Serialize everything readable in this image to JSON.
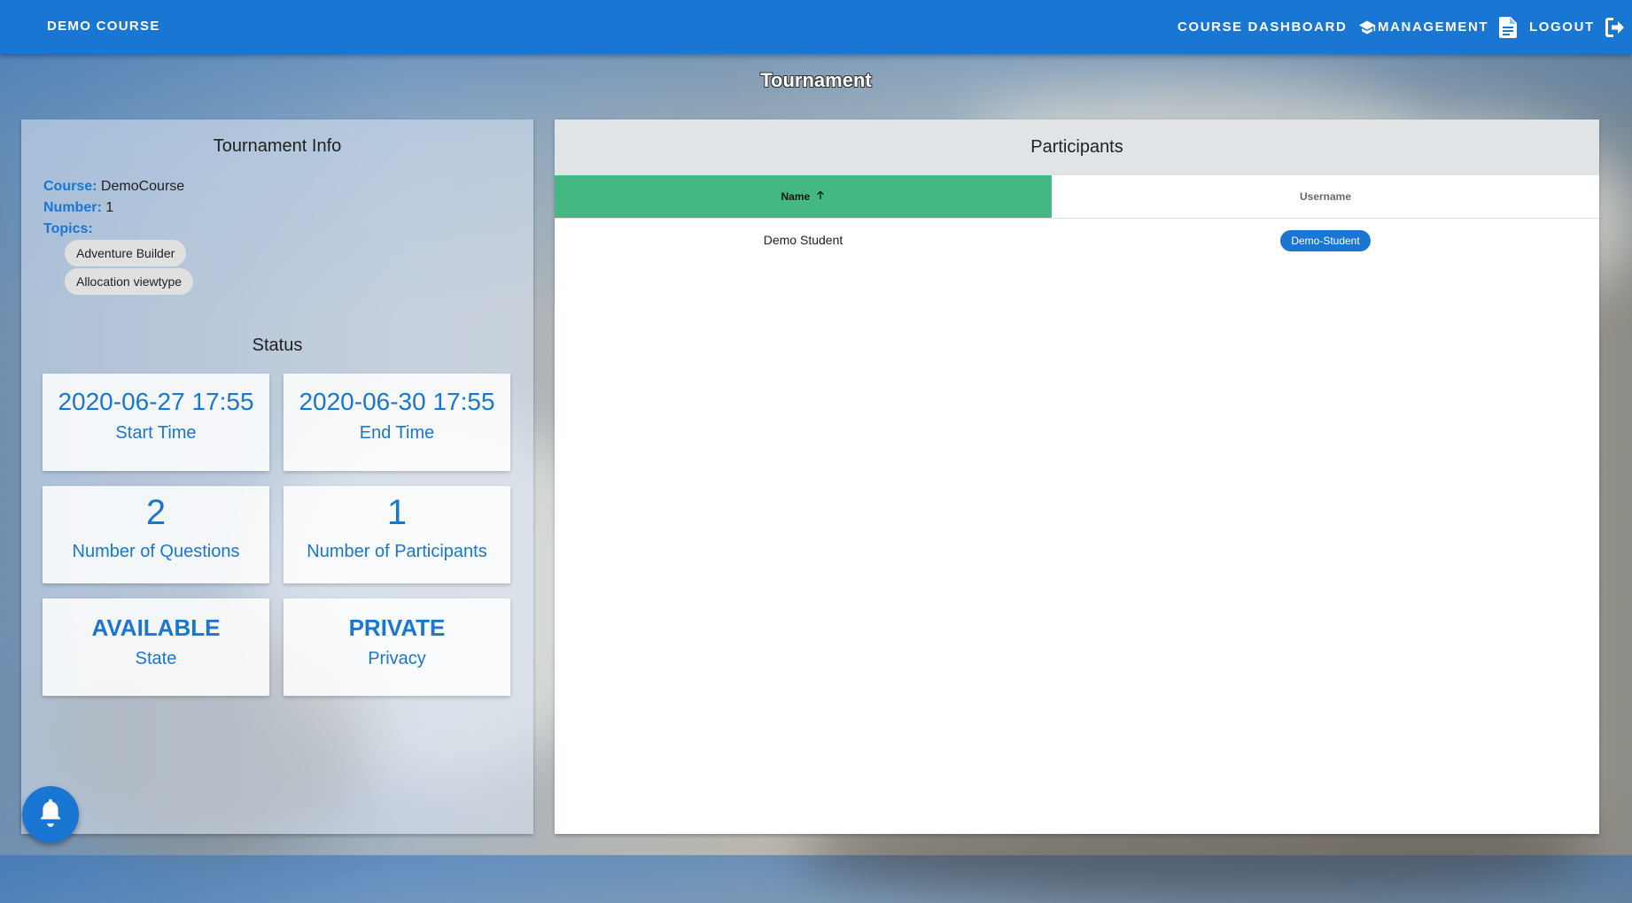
{
  "topbar": {
    "brand": "DEMO COURSE",
    "nav": [
      {
        "label": "COURSE DASHBOARD",
        "icon": "school-icon"
      },
      {
        "label": "MANAGEMENT",
        "icon": "document-icon"
      },
      {
        "label": "LOGOUT",
        "icon": "logout-icon"
      }
    ]
  },
  "page": {
    "title": "Tournament"
  },
  "info": {
    "heading": "Tournament Info",
    "course_key": "Course:",
    "course_value": "DemoCourse",
    "number_key": "Number:",
    "number_value": "1",
    "topics_key": "Topics:",
    "topics": [
      "Adventure Builder",
      "Allocation viewtype"
    ]
  },
  "status": {
    "heading": "Status",
    "cards": [
      {
        "value": "2020-06-27 17:55",
        "label": "Start Time"
      },
      {
        "value": "2020-06-30 17:55",
        "label": "End Time"
      },
      {
        "value": "2",
        "label": "Number of Questions"
      },
      {
        "value": "1",
        "label": "Number of Participants"
      },
      {
        "value": "AVAILABLE",
        "label": "State"
      },
      {
        "value": "PRIVATE",
        "label": "Privacy"
      }
    ]
  },
  "participants": {
    "heading": "Participants",
    "columns": [
      "Name",
      "Username"
    ],
    "rows": [
      {
        "name": "Demo Student",
        "username": "Demo-Student"
      }
    ]
  },
  "colors": {
    "primary": "#1976d2",
    "sorted_header": "#43b883"
  },
  "fab": {
    "icon": "bell-icon"
  }
}
